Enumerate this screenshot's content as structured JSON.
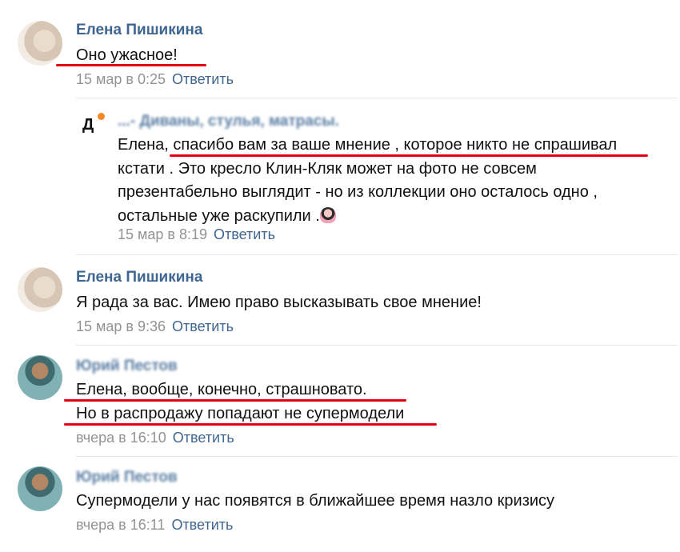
{
  "comments": [
    {
      "author": "Елена Пишикина",
      "lines": [
        "Оно ужасное!"
      ],
      "date": "15 мар в 0:25",
      "reply_label": "Ответить"
    },
    {
      "author": "...- Диваны, стулья, матрасы.",
      "lines": [
        "Елена, спасибо вам за ваше мнение , которое никто не спрашивал",
        "кстати . Это кресло Клин-Кляк может на фото не совсем",
        "презентабельно выглядит - но из коллекции оно осталось одно ,",
        "остальные уже раскупили ."
      ],
      "lead_word": "Елена,",
      "logo_letter": "Д",
      "date": "15 мар в 8:19",
      "reply_label": "Ответить"
    },
    {
      "author": "Елена Пишикина",
      "lines": [
        "Я рада за вас. Имею право высказывать свое мнение!"
      ],
      "date": "15 мар в 9:36",
      "reply_label": "Ответить"
    },
    {
      "author": "Юрий Пестов",
      "lines": [
        "Елена, вообще, конечно, страшновато.",
        "Но в распродажу попадают не супермодели"
      ],
      "date": "вчера в 16:10",
      "reply_label": "Ответить"
    },
    {
      "author": "Юрий Пестов",
      "lines": [
        "Супермодели у нас появятся в ближайшее время назло кризису"
      ],
      "date": "вчера в 16:11",
      "reply_label": "Ответить"
    }
  ],
  "colors": {
    "author": "#3f6690",
    "reply": "#3f6690",
    "date": "#939393",
    "text": "#111111",
    "highlight": "#e3000f"
  }
}
